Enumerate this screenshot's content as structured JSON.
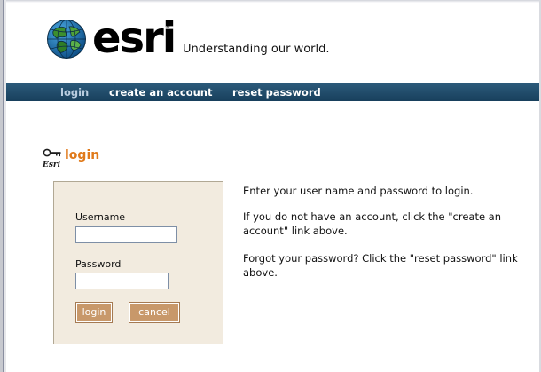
{
  "brand": {
    "logo_text": "esri",
    "registered": "®",
    "tagline": "Understanding our world."
  },
  "nav": {
    "items": [
      {
        "label": "login",
        "active": true
      },
      {
        "label": "create an account",
        "active": false
      },
      {
        "label": "reset password",
        "active": false
      }
    ]
  },
  "section": {
    "icon": "esri-key-icon",
    "icon_text": "Esri",
    "title": "login"
  },
  "form": {
    "username_label": "Username",
    "username_value": "",
    "password_label": "Password",
    "password_value": "",
    "login_button": "login",
    "cancel_button": "cancel"
  },
  "info": {
    "line1": "Enter your user name and password to login.",
    "line2": "If you do not have an account, click the \"create an account\" link above.",
    "line3": "Forgot your password? Click the \"reset password\" link above."
  },
  "colors": {
    "nav_bar": "#1f4a68",
    "accent_orange": "#e07a1b",
    "form_bg": "#f2ebdf",
    "button_bg": "#c8986a"
  }
}
